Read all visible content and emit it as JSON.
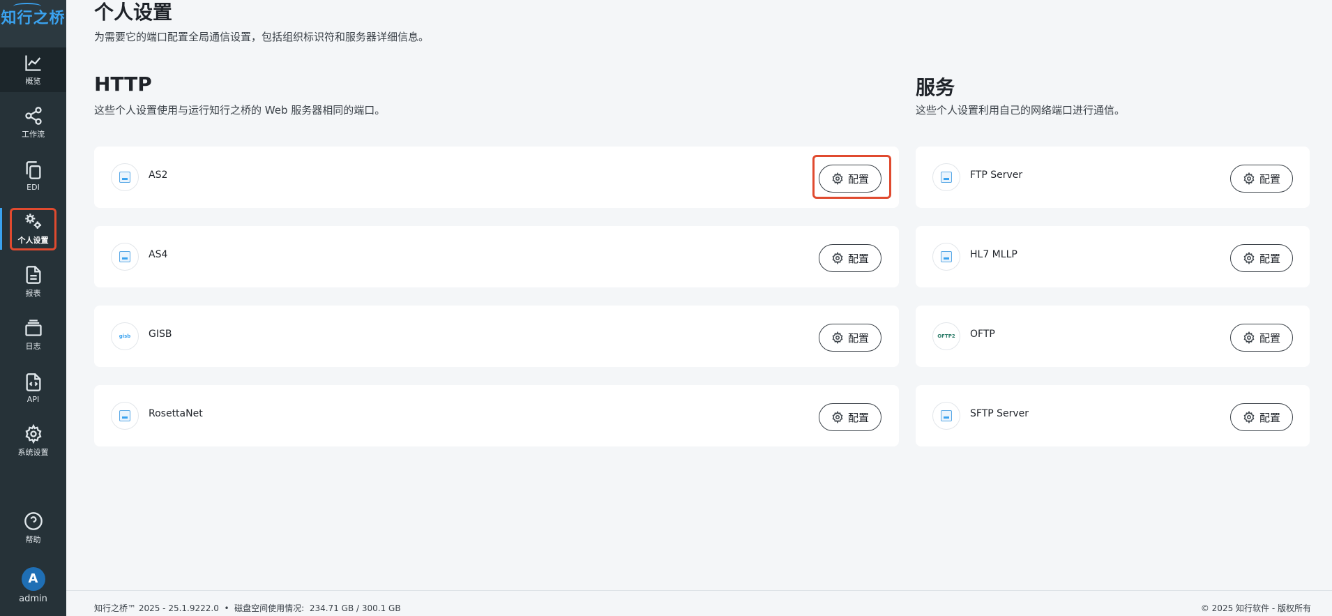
{
  "brand": {
    "name": "知行之桥"
  },
  "sidebar": {
    "items": [
      {
        "label": "概览",
        "icon": "chart-line-icon"
      },
      {
        "label": "工作流",
        "icon": "share-nodes-icon"
      },
      {
        "label": "EDI",
        "icon": "copy-icon"
      },
      {
        "label": "个人设置",
        "icon": "gears-icon"
      },
      {
        "label": "报表",
        "icon": "document-icon"
      },
      {
        "label": "日志",
        "icon": "layers-icon"
      },
      {
        "label": "API",
        "icon": "code-file-icon"
      },
      {
        "label": "系统设置",
        "icon": "gear-icon"
      },
      {
        "label": "帮助",
        "icon": "help-icon"
      }
    ],
    "user": {
      "initial": "A",
      "name": "admin"
    }
  },
  "page": {
    "title": "个人设置",
    "description": "为需要它的端口配置全局通信设置，包括组织标识符和服务器详细信息。"
  },
  "sections": {
    "http": {
      "title": "HTTP",
      "description": "这些个人设置使用与运行知行之桥的 Web 服务器相同的端口。",
      "items": [
        {
          "name": "AS2",
          "button": "配置"
        },
        {
          "name": "AS4",
          "button": "配置"
        },
        {
          "name": "GISB",
          "button": "配置"
        },
        {
          "name": "RosettaNet",
          "button": "配置"
        }
      ]
    },
    "services": {
      "title": "服务",
      "description": "这些个人设置利用自己的网络端口进行通信。",
      "items": [
        {
          "name": "FTP Server",
          "button": "配置"
        },
        {
          "name": "HL7 MLLP",
          "button": "配置"
        },
        {
          "name": "OFTP",
          "button": "配置"
        },
        {
          "name": "SFTP Server",
          "button": "配置"
        }
      ]
    }
  },
  "footer": {
    "left": "知行之桥™ 2025 - 25.1.9222.0  •  磁盘空间使用情况:  234.71 GB / 300.1 GB",
    "right": "© 2025 知行软件 - 版权所有"
  },
  "colors": {
    "accent": "#3aa2ef",
    "highlight": "#e04a2f",
    "sidebar": "#263238"
  }
}
